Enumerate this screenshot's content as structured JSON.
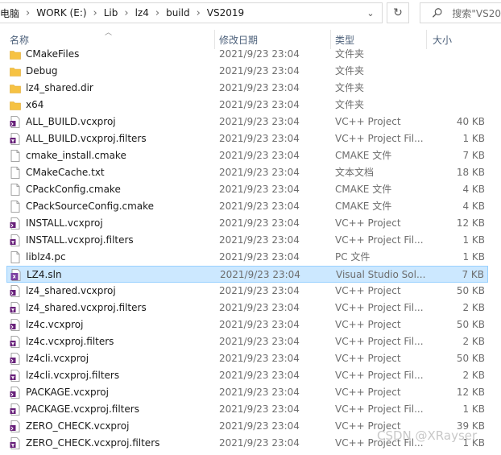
{
  "address": {
    "crumbs": [
      "电脑",
      "WORK (E:)",
      "Lib",
      "lz4",
      "build",
      "VS2019"
    ]
  },
  "search": {
    "placeholder": "搜索\"VS20"
  },
  "columns": {
    "name": "名称",
    "date": "修改日期",
    "type": "类型",
    "size": "大小"
  },
  "files": [
    {
      "name": "CMakeFiles",
      "date": "2021/9/23 23:04",
      "type": "文件夹",
      "size": "",
      "icon": "folder-icon"
    },
    {
      "name": "Debug",
      "date": "2021/9/23 23:04",
      "type": "文件夹",
      "size": "",
      "icon": "folder-icon"
    },
    {
      "name": "lz4_shared.dir",
      "date": "2021/9/23 23:04",
      "type": "文件夹",
      "size": "",
      "icon": "folder-icon"
    },
    {
      "name": "x64",
      "date": "2021/9/23 23:04",
      "type": "文件夹",
      "size": "",
      "icon": "folder-icon"
    },
    {
      "name": "ALL_BUILD.vcxproj",
      "date": "2021/9/23 23:04",
      "type": "VC++ Project",
      "size": "40 KB",
      "icon": "vcxproj-icon"
    },
    {
      "name": "ALL_BUILD.vcxproj.filters",
      "date": "2021/9/23 23:04",
      "type": "VC++ Project Fil...",
      "size": "1 KB",
      "icon": "vcxproj-filters-icon"
    },
    {
      "name": "cmake_install.cmake",
      "date": "2021/9/23 23:04",
      "type": "CMAKE 文件",
      "size": "7 KB",
      "icon": "document-icon"
    },
    {
      "name": "CMakeCache.txt",
      "date": "2021/9/23 23:04",
      "type": "文本文档",
      "size": "18 KB",
      "icon": "document-icon"
    },
    {
      "name": "CPackConfig.cmake",
      "date": "2021/9/23 23:04",
      "type": "CMAKE 文件",
      "size": "4 KB",
      "icon": "document-icon"
    },
    {
      "name": "CPackSourceConfig.cmake",
      "date": "2021/9/23 23:04",
      "type": "CMAKE 文件",
      "size": "4 KB",
      "icon": "document-icon"
    },
    {
      "name": "INSTALL.vcxproj",
      "date": "2021/9/23 23:04",
      "type": "VC++ Project",
      "size": "12 KB",
      "icon": "vcxproj-icon"
    },
    {
      "name": "INSTALL.vcxproj.filters",
      "date": "2021/9/23 23:04",
      "type": "VC++ Project Fil...",
      "size": "1 KB",
      "icon": "vcxproj-filters-icon"
    },
    {
      "name": "liblz4.pc",
      "date": "2021/9/23 23:04",
      "type": "PC 文件",
      "size": "1 KB",
      "icon": "document-icon"
    },
    {
      "name": "LZ4.sln",
      "date": "2021/9/23 23:04",
      "type": "Visual Studio Sol...",
      "size": "7 KB",
      "icon": "sln-icon",
      "selected": true
    },
    {
      "name": "lz4_shared.vcxproj",
      "date": "2021/9/23 23:04",
      "type": "VC++ Project",
      "size": "50 KB",
      "icon": "vcxproj-icon"
    },
    {
      "name": "lz4_shared.vcxproj.filters",
      "date": "2021/9/23 23:04",
      "type": "VC++ Project Fil...",
      "size": "2 KB",
      "icon": "vcxproj-filters-icon"
    },
    {
      "name": "lz4c.vcxproj",
      "date": "2021/9/23 23:04",
      "type": "VC++ Project",
      "size": "50 KB",
      "icon": "vcxproj-icon"
    },
    {
      "name": "lz4c.vcxproj.filters",
      "date": "2021/9/23 23:04",
      "type": "VC++ Project Fil...",
      "size": "2 KB",
      "icon": "vcxproj-filters-icon"
    },
    {
      "name": "lz4cli.vcxproj",
      "date": "2021/9/23 23:04",
      "type": "VC++ Project",
      "size": "50 KB",
      "icon": "vcxproj-icon"
    },
    {
      "name": "lz4cli.vcxproj.filters",
      "date": "2021/9/23 23:04",
      "type": "VC++ Project Fil...",
      "size": "2 KB",
      "icon": "vcxproj-filters-icon"
    },
    {
      "name": "PACKAGE.vcxproj",
      "date": "2021/9/23 23:04",
      "type": "VC++ Project",
      "size": "12 KB",
      "icon": "vcxproj-icon"
    },
    {
      "name": "PACKAGE.vcxproj.filters",
      "date": "2021/9/23 23:04",
      "type": "VC++ Project Fil...",
      "size": "1 KB",
      "icon": "vcxproj-filters-icon"
    },
    {
      "name": "ZERO_CHECK.vcxproj",
      "date": "2021/9/23 23:04",
      "type": "VC++ Project",
      "size": "39 KB",
      "icon": "vcxproj-icon"
    },
    {
      "name": "ZERO_CHECK.vcxproj.filters",
      "date": "2021/9/23 23:04",
      "type": "VC++ Project Fil...",
      "size": "1 KB",
      "icon": "vcxproj-filters-icon"
    }
  ],
  "watermark": "CSDN @XRayser",
  "colors": {
    "selection_bg": "#cce8ff",
    "selection_border": "#99d1ff",
    "folder": "#f6c243",
    "header_text": "#4c607a"
  }
}
